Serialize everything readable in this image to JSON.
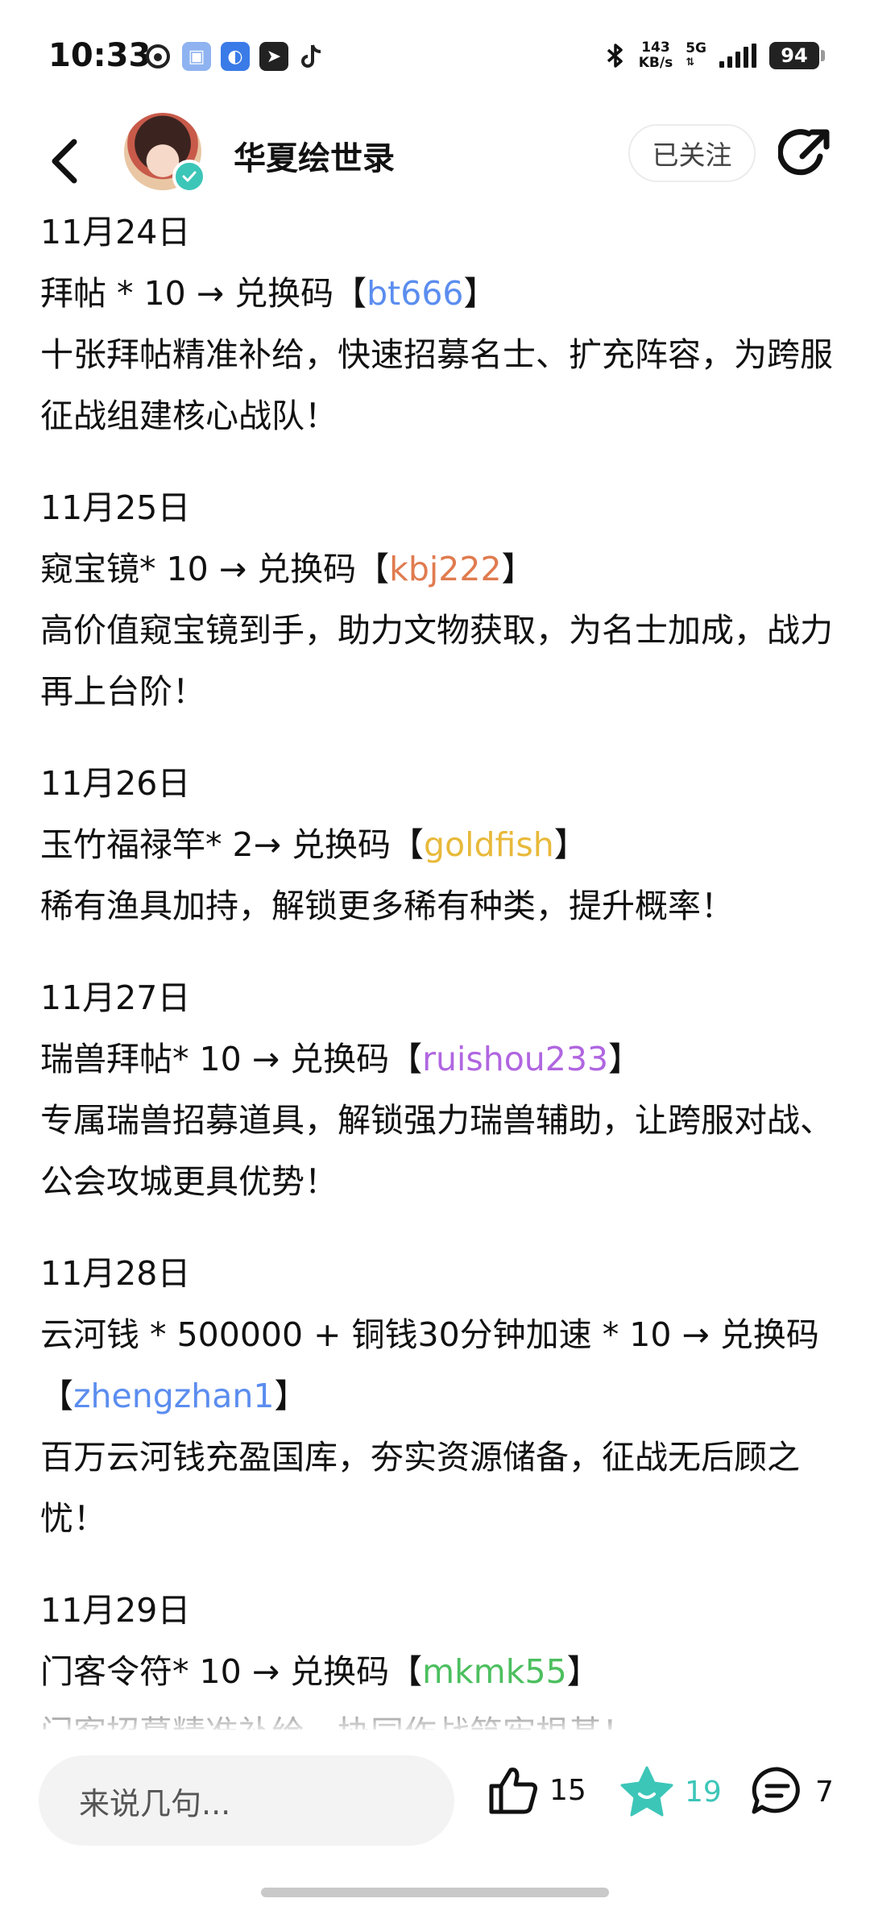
{
  "status_bar": {
    "time": "10:33",
    "network_speed_value": "143",
    "network_speed_unit": "KB/s",
    "network_type": "5G",
    "battery": "94"
  },
  "header": {
    "account_name": "华夏绘世录",
    "follow_label": "已关注"
  },
  "entries": [
    {
      "date": "11月24日",
      "item": "拜帖 * 10 → 兑换码【",
      "code": "bt666",
      "code_color": "#5b8def",
      "tail": "】",
      "desc": "十张拜帖精准补给，快速招募名士、扩充阵容，为跨服征战组建核心战队！"
    },
    {
      "date": "11月25日",
      "item": "窥宝镜* 10 → 兑换码【",
      "code": "kbj222",
      "code_color": "#e07b4f",
      "tail": "】",
      "desc": "高价值窥宝镜到手，助力文物获取，为名士加成，战力再上台阶！"
    },
    {
      "date": "11月26日",
      "item": "玉竹福禄竿* 2→ 兑换码【",
      "code": "goldfish",
      "code_color": "#e8b93a",
      "tail": "】",
      "desc": "稀有渔具加持，解锁更多稀有种类，提升概率！"
    },
    {
      "date": "11月27日",
      "item": "瑞兽拜帖* 10 → 兑换码【",
      "code": "ruishou233",
      "code_color": "#b066e0",
      "tail": "】",
      "desc": "专属瑞兽招募道具，解锁强力瑞兽辅助，让跨服对战、公会攻城更具优势！"
    },
    {
      "date": "11月28日",
      "item": "云河钱 * 500000 + 铜钱30分钟加速 * 10 → 兑换码【",
      "code": "zhengzhan1",
      "code_color": "#5b8def",
      "tail": "】",
      "desc": "百万云河钱充盈国库，夯实资源储备，征战无后顾之忧！"
    },
    {
      "date": "11月29日",
      "item": "门客令符* 10 → 兑换码【",
      "code": "mkmk55",
      "code_color": "#4cbf5f",
      "tail": "】",
      "desc": "门客招募精准补给，协同作战筑牢根基！"
    }
  ],
  "bottom_bar": {
    "comment_placeholder": "来说几句...",
    "like_count": "15",
    "collect_count": "19",
    "comment_count": "7"
  },
  "colors": {
    "accent_teal": "#3cc6b8",
    "text_primary": "#111111"
  },
  "icons": [
    "back-arrow-icon",
    "verified-badge-icon",
    "share-icon",
    "thumbs-up-icon",
    "star-collect-icon",
    "comment-bubble-icon",
    "bluetooth-icon"
  ]
}
